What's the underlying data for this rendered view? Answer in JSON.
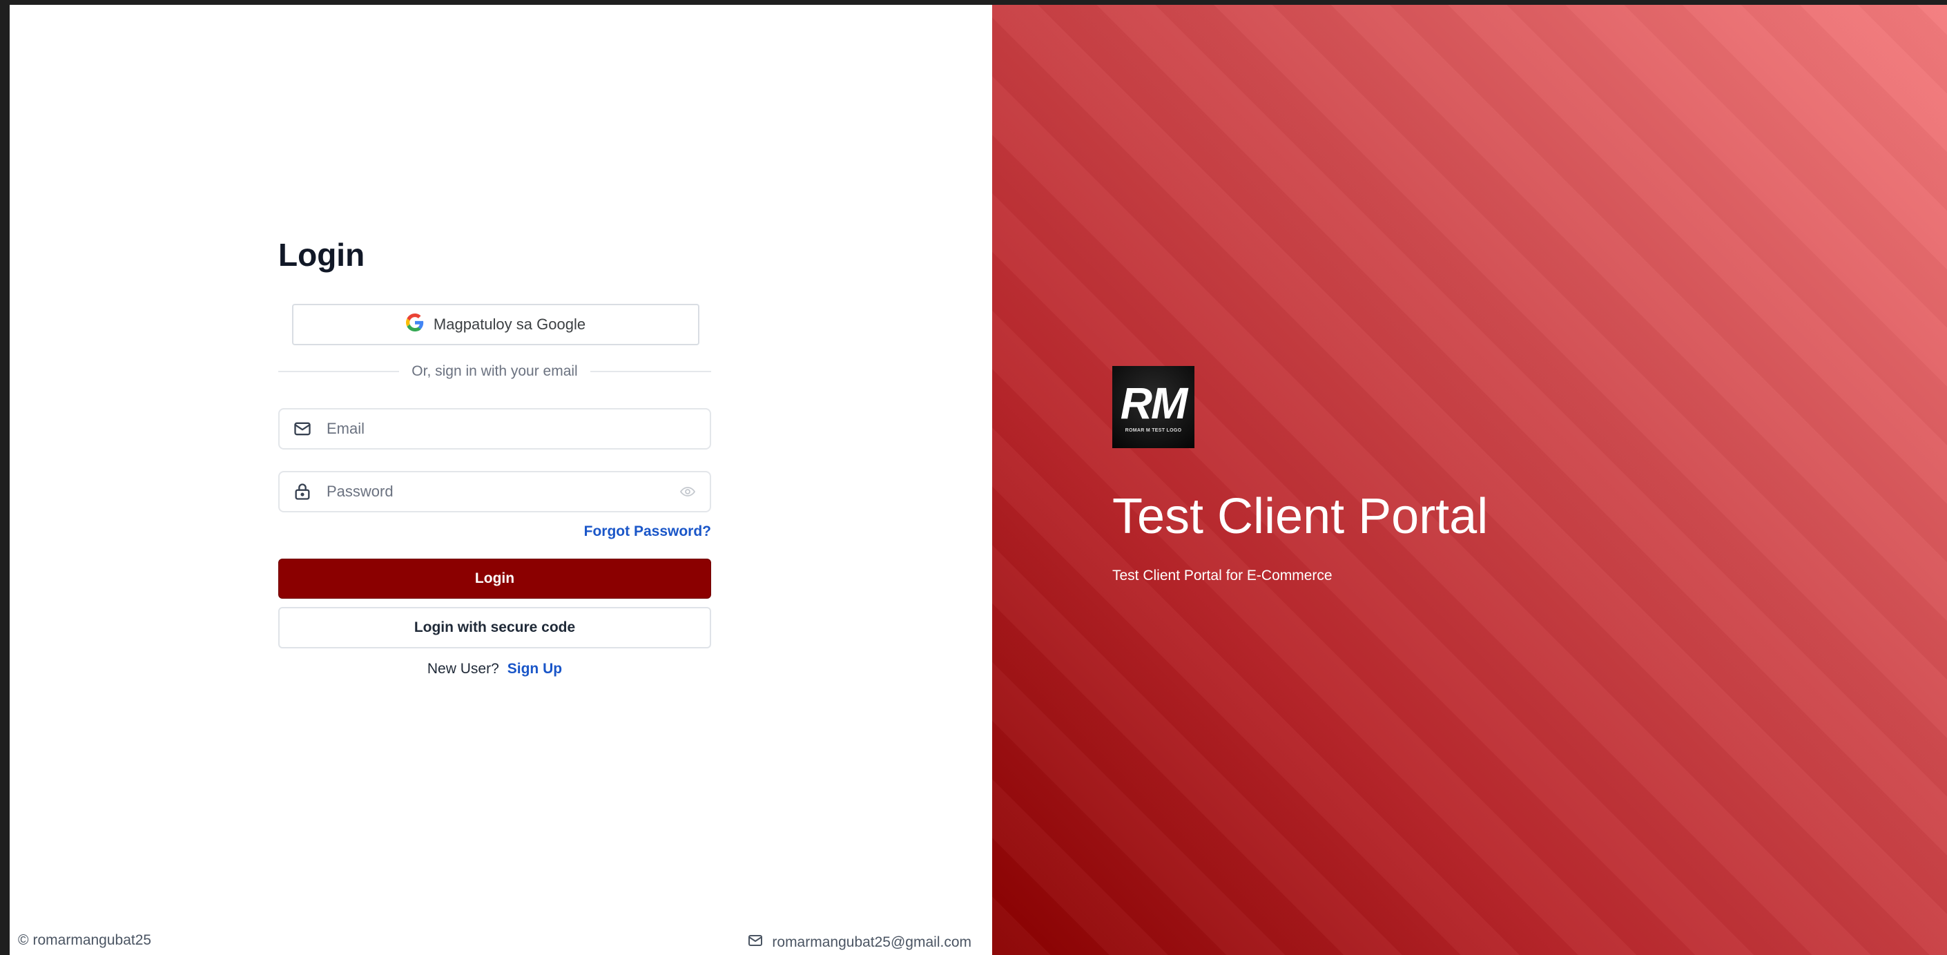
{
  "login": {
    "title": "Login",
    "google_button_label": "Magpatuloy sa Google",
    "divider_text": "Or, sign in with your email",
    "email_placeholder": "Email",
    "password_placeholder": "Password",
    "forgot_password": "Forgot Password?",
    "login_button": "Login",
    "secure_code_button": "Login with secure code",
    "new_user_text": "New User?",
    "sign_up_link": "Sign Up"
  },
  "footer": {
    "copyright_symbol": "©",
    "username": "romarmangubat25",
    "email": "romarmangubat25@gmail.com"
  },
  "brand": {
    "logo_text": "RM",
    "logo_tagline": "ROMAR M TEST LOGO",
    "portal_title": "Test Client Portal",
    "portal_subtitle": "Test Client Portal for E-Commerce"
  },
  "icons": {
    "google": "google-icon",
    "email": "mail-icon",
    "password": "lock-icon",
    "visibility": "eye-icon",
    "footer_email": "mail-icon"
  },
  "colors": {
    "primary_button": "#8b0000",
    "link": "#1a56c8",
    "gradient_start": "#8a0000",
    "gradient_end": "#f47c7e"
  }
}
